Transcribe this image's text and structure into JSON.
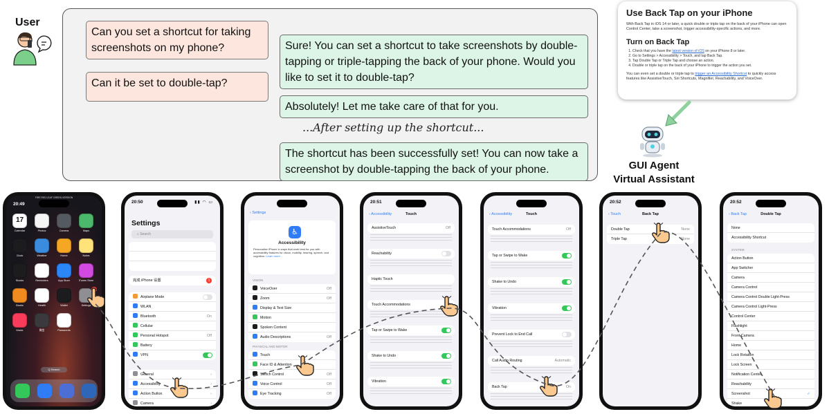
{
  "user_label": "User",
  "agent_label_line1": "GUI Agent",
  "agent_label_line2": "Virtual Assistant",
  "conversation": {
    "user_1": "Can you set a shortcut for taking screenshots on my phone?",
    "agent_1": "Sure! You can set a shortcut to take screenshots by double-tapping or triple-tapping the back of your phone. Would you like to set it to double-tap?",
    "user_2": "Can it be set to double-tap?",
    "agent_2": "Absolutely! Let me take care of that for you.",
    "transition": "...After setting up the shortcut...",
    "agent_3": "The shortcut has been successfully set! You can now take a screenshot by double-tapping the back of your phone."
  },
  "doc": {
    "title": "Use Back Tap on your iPhone",
    "intro": "With Back Tap in iOS 14 or later, a quick double or triple tap on the back of your iPhone can open Control Center, take a screenshot, trigger accessibility-specific actions, and more.",
    "subtitle": "Turn on Back Tap",
    "step1_pre": "Check that you have the ",
    "step1_link": "latest version of iOS",
    "step1_post": " on your iPhone 8 or later.",
    "step2": "Go to Settings > Accessibility > Touch, and tap Back Tap.",
    "step3": "Tap Double Tap or Triple Tap and choose an action.",
    "step4": "Double or triple tap on the back of your iPhone to trigger the action you set.",
    "outro_pre": "You can even set a double or triple tap to ",
    "outro_link": "trigger an Accessibility Shortcut",
    "outro_post": " to quickly access features like AssistiveTouch, Siri Shortcuts, Magnifier, Reachability, and VoiceOver."
  },
  "phone1": {
    "time": "20:49",
    "carrier": "FIRE RED  LEAF GREEN VERSION",
    "apps": [
      {
        "label": "Calendar",
        "color": "#ffffff"
      },
      {
        "label": "Photos",
        "color": "#f5f5f5"
      },
      {
        "label": "Camera",
        "color": "#555a60"
      },
      {
        "label": "Maps",
        "color": "#4cb86b"
      },
      {
        "label": "Clock",
        "color": "#1c1c1e"
      },
      {
        "label": "Weather",
        "color": "#3a8dde"
      },
      {
        "label": "Home",
        "color": "#f5a623"
      },
      {
        "label": "Notes",
        "color": "#ffe27a"
      },
      {
        "label": "Stocks",
        "color": "#1c1c1e"
      },
      {
        "label": "Reminders",
        "color": "#ffffff"
      },
      {
        "label": "App Store",
        "color": "#2b86f7"
      },
      {
        "label": "iTunes Store",
        "color": "#d24ae0"
      },
      {
        "label": "Books",
        "color": "#f08c1f"
      },
      {
        "label": "Health",
        "color": "#ffffff"
      },
      {
        "label": "Wallet",
        "color": "#1c1c1e"
      },
      {
        "label": "Settings",
        "color": "#8e8e93"
      },
      {
        "label": "Music",
        "color": "#fa3c5a"
      },
      {
        "label": "微信",
        "color": "#3a3a3c"
      },
      {
        "label": "Passwords",
        "color": "#ffffff"
      }
    ],
    "calendar_day": "17",
    "settings_badge": "1",
    "search_pill": "Q Search",
    "dock_colors": [
      "#34c759",
      "#2f7cf6",
      "#4b6fd4",
      "#2e67b8"
    ]
  },
  "phone2": {
    "time": "20:50",
    "title": "Settings",
    "search": "Search",
    "finish_row": "完成 iPhone 设置",
    "finish_badge": "1",
    "rows": [
      {
        "label": "Airplane Mode",
        "value": "",
        "color": "#f19a37"
      },
      {
        "label": "WLAN",
        "value": "",
        "color": "#2f7cf6"
      },
      {
        "label": "Bluetooth",
        "value": "On",
        "color": "#2f7cf6"
      },
      {
        "label": "Cellular",
        "value": "",
        "color": "#34c759"
      },
      {
        "label": "Personal Hotspot",
        "value": "Off",
        "color": "#34c759"
      },
      {
        "label": "Battery",
        "value": "",
        "color": "#34c759"
      },
      {
        "label": "VPN",
        "value": "",
        "color": "#2f7cf6"
      }
    ],
    "rows2": [
      {
        "label": "General",
        "color": "#8e8e93"
      },
      {
        "label": "Accessibility",
        "color": "#2f7cf6"
      },
      {
        "label": "Action Button",
        "color": "#2f7cf6"
      },
      {
        "label": "Camera",
        "color": "#8e8e93"
      }
    ]
  },
  "phone3": {
    "back": "Settings",
    "title": "Accessibility",
    "desc": "Personalize iPhone in ways that work best for you with accessibility features for vision, mobility, hearing, speech, and cognition.",
    "learn_more": "Learn more...",
    "section_vision": "VISION",
    "section_physical": "PHYSICAL AND MOTOR",
    "vision_rows": [
      {
        "label": "VoiceOver",
        "value": "Off"
      },
      {
        "label": "Zoom",
        "value": "Off"
      },
      {
        "label": "Display & Text Size",
        "value": ""
      },
      {
        "label": "Motion",
        "value": ""
      },
      {
        "label": "Spoken Content",
        "value": ""
      },
      {
        "label": "Audio Descriptions",
        "value": "Off"
      }
    ],
    "motor_rows": [
      {
        "label": "Touch",
        "value": ""
      },
      {
        "label": "Face ID & Attention",
        "value": ""
      },
      {
        "label": "Switch Control",
        "value": "Off"
      },
      {
        "label": "Voice Control",
        "value": "Off"
      },
      {
        "label": "Eye Tracking",
        "value": "Off"
      }
    ]
  },
  "phone4": {
    "time": "20:51",
    "back": "Accessibility",
    "title": "Touch",
    "rows": [
      {
        "label": "AssistiveTouch",
        "value": "Off"
      },
      {
        "label": "Reachability",
        "value": ""
      },
      {
        "label": "Haptic Touch",
        "value": ""
      },
      {
        "label": "Touch Accommodations",
        "value": "Off"
      },
      {
        "label": "Tap or Swipe to Wake",
        "value": ""
      },
      {
        "label": "Shake to Undo",
        "value": ""
      },
      {
        "label": "Vibration",
        "value": ""
      }
    ]
  },
  "phone5": {
    "back": "Accessibility",
    "title": "Touch",
    "rows": [
      {
        "label": "Touch Accommodations",
        "value": "Off"
      },
      {
        "label": "Tap or Swipe to Wake",
        "value": ""
      },
      {
        "label": "Shake to Undo",
        "value": ""
      },
      {
        "label": "Vibration",
        "value": ""
      },
      {
        "label": "Prevent Lock to End Call",
        "value": ""
      },
      {
        "label": "Call Audio Routing",
        "value": "Automatic"
      },
      {
        "label": "Back Tap",
        "value": "On"
      }
    ]
  },
  "phone6": {
    "time": "20:52",
    "back": "Touch",
    "title": "Back Tap",
    "rows": [
      {
        "label": "Double Tap",
        "value": "None"
      },
      {
        "label": "Triple Tap",
        "value": "None"
      }
    ]
  },
  "phone7": {
    "time": "20:52",
    "back": "Back Tap",
    "title": "Double Tap",
    "rows_top": [
      "None",
      "Accessibility Shortcut"
    ],
    "section": "SYSTEM",
    "rows": [
      "Action Button",
      "App Switcher",
      "Camera",
      "Camera Control",
      "Camera Control Double Light-Press",
      "Camera Control Light-Press",
      "Control Center",
      "Flashlight",
      "Front Camera",
      "Home",
      "Lock Rotation",
      "Lock Screen",
      "Notification Center",
      "Reachability",
      "Screenshot",
      "Shake"
    ]
  },
  "colors": {
    "user_bubble": "#fde6dd",
    "agent_bubble": "#dcf5e6",
    "ios_blue": "#2f7cf6",
    "toggle_green": "#34c759",
    "arrow_green": "#8fd19e"
  }
}
